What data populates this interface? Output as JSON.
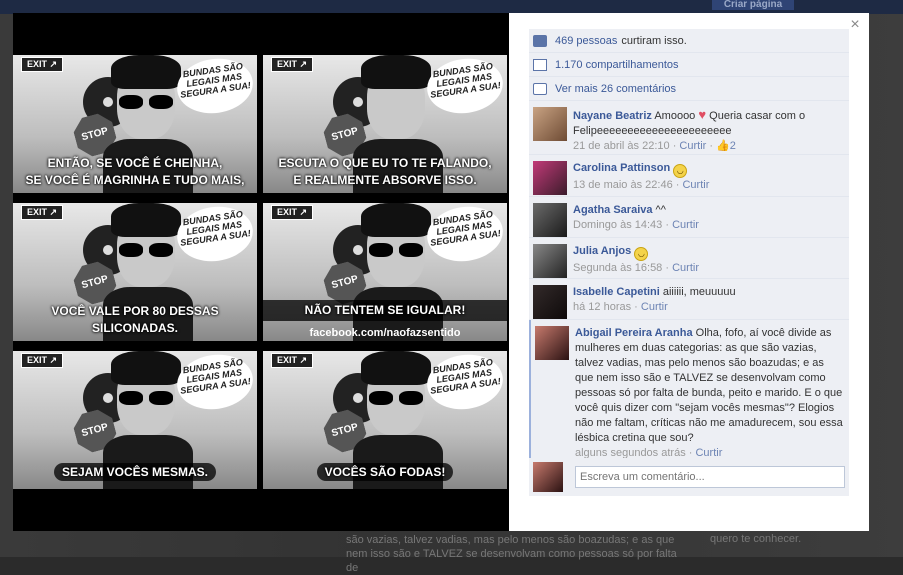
{
  "background": {
    "top_button": "Criar página",
    "bottom_text": "são vazias, talvez vadias, mas pelo menos são boazudas; e as que nem isso são e TALVEZ se desenvolvam como pessoas só por falta de",
    "bottom_right_text": "quero te conhecer."
  },
  "photo": {
    "panels": [
      {
        "exit": "EXIT ↗",
        "stop": "STOP",
        "bubble": "BUNDAS SÃO LEGAIS MAS SEGURA A SUA!",
        "caption": "ENTÃO, SE VOCÊ É CHEINHA,\nSE VOCÊ É MAGRINHA E TUDO MAIS,"
      },
      {
        "exit": "EXIT ↗",
        "stop": "STOP",
        "bubble": "BUNDAS SÃO LEGAIS MAS SEGURA A SUA!",
        "caption": "ESCUTA O QUE EU TO TE FALANDO,\nE REALMENTE ABSORVE ISSO."
      },
      {
        "exit": "EXIT ↗",
        "stop": "STOP",
        "bubble": "BUNDAS SÃO LEGAIS MAS SEGURA A SUA!",
        "caption": "VOCÊ VALE POR 80 DESSAS\nSILICONADAS."
      },
      {
        "exit": "EXIT ↗",
        "stop": "STOP",
        "bubble": "BUNDAS SÃO LEGAIS MAS SEGURA A SUA!",
        "caption": "NÃO TENTEM SE IGUALAR!",
        "site": "facebook.com/naofazsentido"
      },
      {
        "exit": "EXIT ↗",
        "stop": "STOP",
        "bubble": "BUNDAS SÃO LEGAIS MAS SEGURA A SUA!",
        "caption": "SEJAM VOCÊS MESMAS."
      },
      {
        "exit": "EXIT ↗",
        "stop": "STOP",
        "bubble": "BUNDAS SÃO LEGAIS MAS SEGURA A SUA!",
        "caption": "VOCÊS SÃO FODAS!"
      }
    ]
  },
  "sidebar": {
    "close": "×",
    "likes_link": "469 pessoas",
    "likes_rest": "curtiram isso.",
    "shares": "1.170 compartilhamentos",
    "more_comments": "Ver mais 26 comentários",
    "comments": [
      {
        "author": "Nayane Beatriz",
        "text_before": "Amoooo",
        "text_after": "Queria casar com o Felipeeeeeeeeeeeeeeeeeeeeee",
        "time": "21 de abril às 22:10",
        "sep": " · ",
        "action": "Curtir",
        "likes": "2"
      },
      {
        "author": "Carolina Pattinson",
        "time": "13 de maio às 22:46",
        "sep": " · ",
        "action": "Curtir"
      },
      {
        "author": "Agatha Saraiva",
        "text": "^^",
        "time": "Domingo às 14:43",
        "sep": " · ",
        "action": "Curtir"
      },
      {
        "author": "Julia Anjos",
        "time": "Segunda às 16:58",
        "sep": " · ",
        "action": "Curtir"
      },
      {
        "author": "Isabelle Capetini",
        "text": "aiiiiii, meuuuuu",
        "time": "há 12 horas",
        "sep": " · ",
        "action": "Curtir"
      },
      {
        "author": "Abigail Pereira Aranha",
        "text": "Olha, fofo, aí você divide as mulheres em duas categorias: as que são vazias, talvez vadias, mas pelo menos são boazudas; e as que nem isso são e TALVEZ se desenvolvam como pessoas só por falta de bunda, peito e marido. E o que você quis dizer com \"sejam vocês mesmas\"? Elogios não me faltam, críticas não me amadurecem, sou essa lésbica cretina que sou?",
        "time": "alguns segundos atrás",
        "sep": " · ",
        "action": "Curtir"
      }
    ],
    "compose_placeholder": "Escreva um comentário..."
  }
}
